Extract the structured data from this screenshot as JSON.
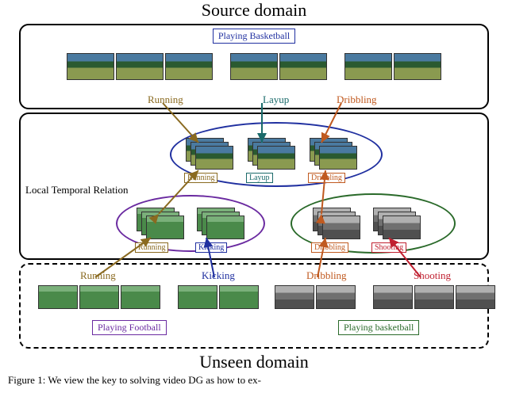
{
  "title_source": "Source domain",
  "source_box": {
    "caption": "Playing Basketball",
    "sub_labels": [
      "Running",
      "Layup",
      "Dribbling"
    ]
  },
  "middle_box": {
    "side_label": "Local Temporal Relation",
    "group_top": [
      "Running",
      "Layup",
      "Dribbling"
    ],
    "group_left": [
      "Running",
      "Kicking"
    ],
    "group_right": [
      "Dribbling",
      "Shooting"
    ]
  },
  "unseen_box": {
    "labels_top": [
      "Running",
      "Kicking",
      "Dribbling",
      "Shooting"
    ],
    "caption_left": "Playing Football",
    "caption_right": "Playing basketball"
  },
  "title_unseen": "Unseen domain",
  "footer": "Figure 1: We view the key to solving video DG as how to ex-"
}
